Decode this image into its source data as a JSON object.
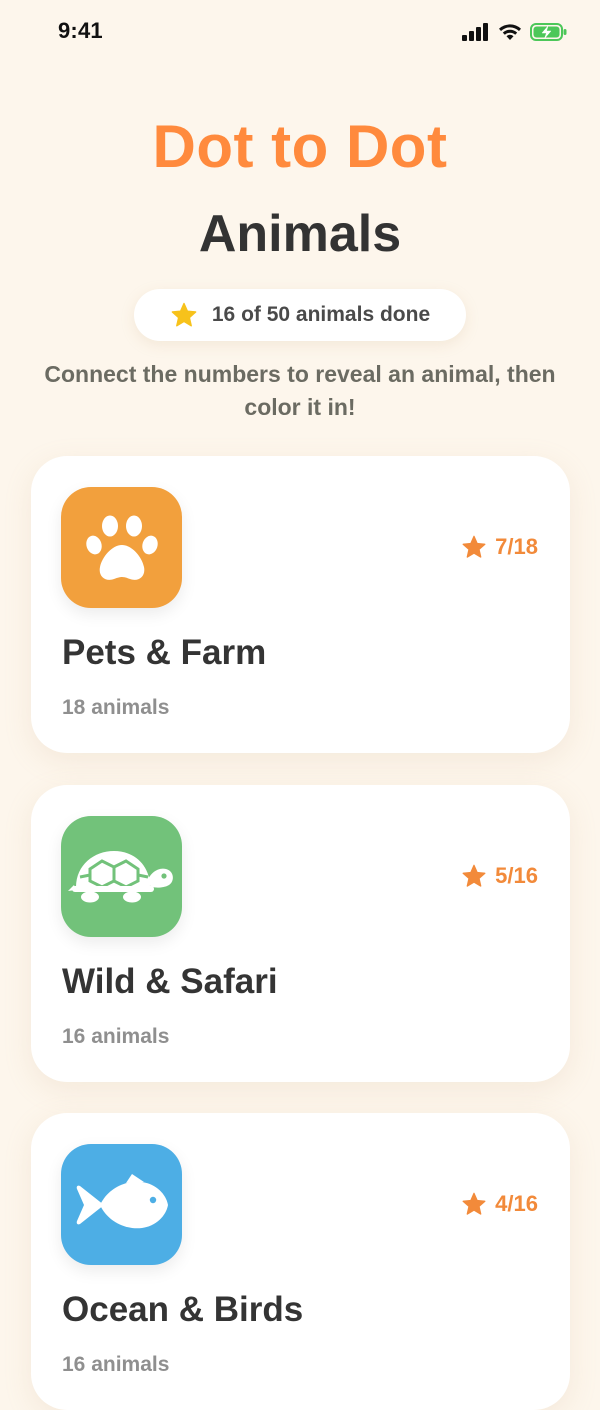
{
  "status_bar": {
    "time": "9:41"
  },
  "header": {
    "app_title": "Dot to Dot",
    "page_title": "Animals",
    "progress_text": "16 of 50 animals done",
    "subtitle": "Connect the numbers to reveal an animal, then color it in!"
  },
  "colors": {
    "background": "#FDF6EC",
    "accent_orange": "#FF8A3D",
    "star_yellow": "#F7C21B",
    "pets_icon_bg": "#F2A03D",
    "wild_icon_bg": "#72C27A",
    "ocean_icon_bg": "#4DAEE5"
  },
  "categories": [
    {
      "title": "Pets & Farm",
      "count_label": "18 animals",
      "score": "7/18",
      "icon": "paw-icon"
    },
    {
      "title": "Wild & Safari",
      "count_label": "16 animals",
      "score": "5/16",
      "icon": "turtle-icon"
    },
    {
      "title": "Ocean & Birds",
      "count_label": "16 animals",
      "score": "4/16",
      "icon": "fish-icon"
    }
  ]
}
